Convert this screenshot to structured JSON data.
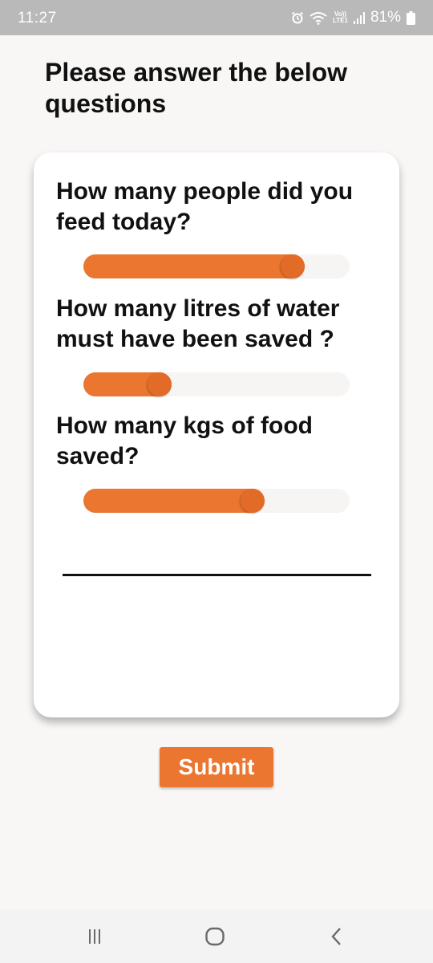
{
  "status_bar": {
    "time": "11:27",
    "icons": [
      "alarm-icon",
      "wifi-icon",
      "volte-lte-icon",
      "signal-icon",
      "battery-icon"
    ],
    "lte_top": "Vo))",
    "lte_bottom": "LTE1",
    "battery_percent": "81%"
  },
  "page": {
    "title": "Please answer the below questions"
  },
  "questions": [
    {
      "label": "How many people did you feed today?",
      "slider_value": 0.83
    },
    {
      "label": "How many litres of water must have been saved ?",
      "slider_value": 0.33
    },
    {
      "label": "How many kgs of food saved?",
      "slider_value": 0.68
    }
  ],
  "submit": {
    "label": "Submit"
  },
  "colors": {
    "accent": "#ea7630",
    "thumb": "#e26c27",
    "track": "#f6f5f4",
    "background": "#f8f7f6",
    "status_bar": "#b9b9b9"
  },
  "nav_bar": {
    "icons": [
      "recent-apps-icon",
      "home-icon",
      "back-icon"
    ]
  }
}
